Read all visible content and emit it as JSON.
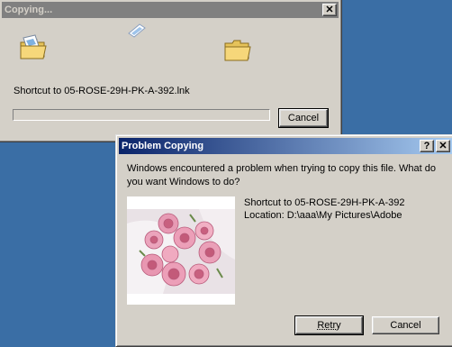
{
  "copy_dialog": {
    "title": "Copying...",
    "file_label": "Shortcut to 05-ROSE-29H-PK-A-392.lnk",
    "cancel_label": "Cancel",
    "progress_fraction": 0,
    "close_glyph": "✕"
  },
  "problem_dialog": {
    "title": "Problem Copying",
    "help_glyph": "?",
    "close_glyph": "✕",
    "message_line1": "Windows encountered a problem when trying to copy this file.  What do",
    "message_line2": "you want Windows to do?",
    "file_name": "Shortcut to 05-ROSE-29H-PK-A-392",
    "location": "Location: D:\\aaa\\My Pictures\\Adobe",
    "retry_label": "Retry",
    "cancel_label": "Cancel"
  },
  "icons": [
    "folder-icon",
    "flying-paper-icon",
    "shortcut-icon",
    "rose-thumbnail"
  ],
  "colors": {
    "desktop": "#3a6ea5",
    "window_face": "#d4d0c8",
    "active_title_start": "#0a246a",
    "active_title_end": "#a6caf0",
    "inactive_title": "#808080"
  }
}
